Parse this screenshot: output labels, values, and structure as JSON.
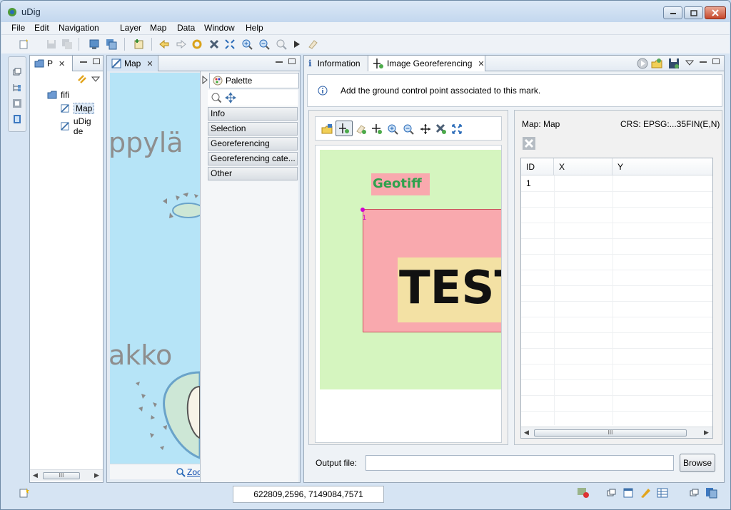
{
  "window": {
    "title": "uDig"
  },
  "menu": [
    "File",
    "Edit",
    "Navigation",
    "Layer",
    "Map",
    "Data",
    "Window",
    "Help"
  ],
  "projects_panel": {
    "tab_label": "P",
    "tree": [
      {
        "label": "fifi"
      },
      {
        "label": "Map"
      },
      {
        "label": "uDig de"
      }
    ],
    "scroll_thumb": "III"
  },
  "map_editor": {
    "tab_label": "Map",
    "labels": [
      "ppylä",
      "akko"
    ],
    "zoom_link": "Zoo",
    "palette": {
      "title": "Palette",
      "drawers": [
        "Info",
        "Selection",
        "Georeferencing",
        "Georeferencing cate...",
        "Other"
      ]
    }
  },
  "georef_view": {
    "tabs": [
      "Information",
      "Image Georeferencing"
    ],
    "message": "Add the ground control point associated to this mark.",
    "image": {
      "label_geotiff": "Geotiff",
      "label_test": "TEST",
      "marker_id": "1"
    },
    "map_header": "Map: Map",
    "crs": "CRS: EPSG:...35FIN(E,N)",
    "table": {
      "columns": [
        "ID",
        "X",
        "Y"
      ],
      "rows": [
        {
          "id": "1",
          "x": "",
          "y": ""
        }
      ],
      "scroll_thumb": "III"
    },
    "output_label": "Output file:",
    "output_value": "",
    "browse_label": "Browse"
  },
  "status": {
    "coordinates": "622809,2596, 7149084,7571"
  },
  "colors": {
    "image_bg": "#d5f5bf",
    "pink_rect": "#f9a9ae",
    "test_bg": "#f3e1a4",
    "geotiff_text": "#2fa24d",
    "map_water": "#b6e4f7"
  }
}
